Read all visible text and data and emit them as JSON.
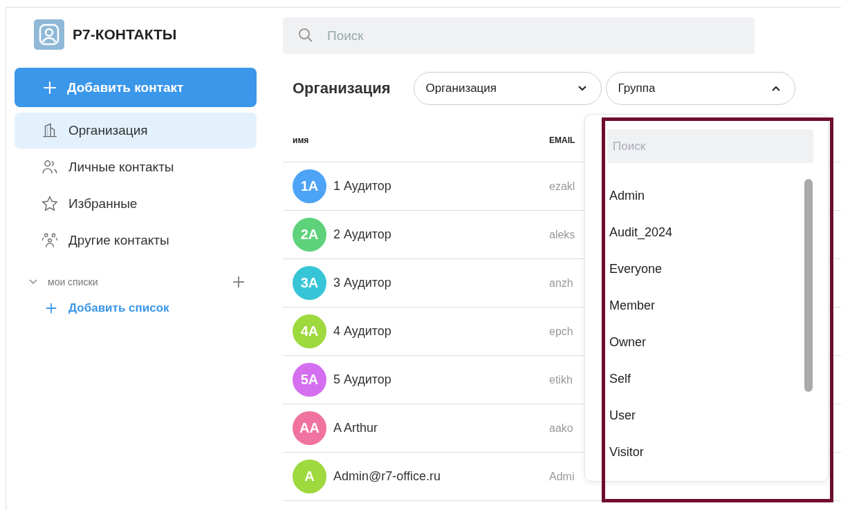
{
  "app": {
    "title": "Р7-КОНТАКТЫ"
  },
  "add_contact_button": {
    "label": "Добавить контакт"
  },
  "sidebar": {
    "items": [
      {
        "label": "Организация",
        "kind": "building",
        "selected": true
      },
      {
        "label": "Личные контакты",
        "kind": "people",
        "selected": false
      },
      {
        "label": "Избранные",
        "kind": "star",
        "selected": false
      },
      {
        "label": "Другие контакты",
        "kind": "group",
        "selected": false
      }
    ],
    "section": {
      "title": "мои списки",
      "expanded": true,
      "add_list": "Добавить список"
    }
  },
  "search": {
    "placeholder": "Поиск"
  },
  "page_title": "Организация",
  "filters": [
    {
      "value": "Организация",
      "expanded": false
    },
    {
      "value": "Группа",
      "expanded": true
    }
  ],
  "table": {
    "columns": [
      "имя",
      "EMAIL"
    ],
    "rows": [
      {
        "initials": "1А",
        "color": "#4da3f5",
        "name": "1 Аудитор",
        "email": "ezakl"
      },
      {
        "initials": "2А",
        "color": "#5ed27a",
        "name": "2 Аудитор",
        "email": "aleks"
      },
      {
        "initials": "3А",
        "color": "#36c5d6",
        "name": "3 Аудитор",
        "email": "anzh"
      },
      {
        "initials": "4А",
        "color": "#9ed93e",
        "name": "4 Аудитор",
        "email": "epch"
      },
      {
        "initials": "5А",
        "color": "#d46ff0",
        "name": "5 Аудитор",
        "email": "etikh"
      },
      {
        "initials": "AA",
        "color": "#f0739f",
        "name": "A Arthur",
        "email": "aako"
      },
      {
        "initials": "A",
        "color": "#9ed93e",
        "name": "Admin@r7-office.ru",
        "email": "Admi"
      }
    ]
  },
  "group_dropdown": {
    "search_placeholder": "Поиск",
    "options": [
      "Admin",
      "Audit_2024",
      "Everyone",
      "Member",
      "Owner",
      "Self",
      "User",
      "Visitor"
    ]
  }
}
